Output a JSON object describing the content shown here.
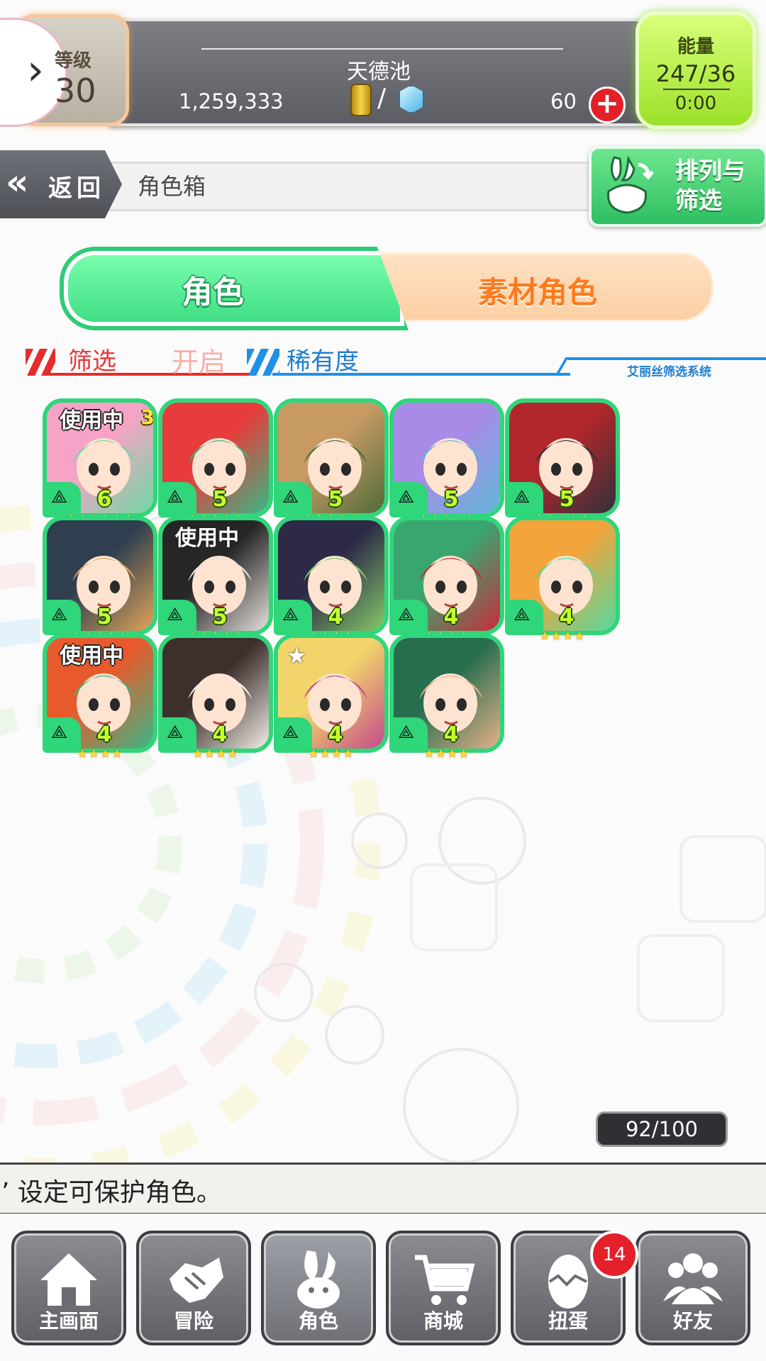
{
  "header": {
    "level_label": "等级",
    "level_value": "30",
    "player_name": "天德池",
    "coins": "1,259,333",
    "gems": "60",
    "energy_label": "能量",
    "energy_value": "247/36",
    "energy_timer": "0:00"
  },
  "nav": {
    "back_label": "返回",
    "page_title": "角色箱",
    "sort_filter_label": "排列与筛选"
  },
  "tabs": {
    "characters": "角色",
    "material_characters": "素材角色"
  },
  "filter": {
    "label": "筛选",
    "state": "开启",
    "sort_key": "稀有度",
    "system_label": "艾丽丝筛选系统"
  },
  "characters": [
    {
      "level": "6",
      "stars": 6,
      "in_use": "使用中",
      "plus": "3",
      "colors": [
        "#f7a3c7",
        "#6dd9a2"
      ]
    },
    {
      "level": "5",
      "stars": 5,
      "colors": [
        "#e83b3b",
        "#37b884"
      ]
    },
    {
      "level": "5",
      "stars": 5,
      "colors": [
        "#c79a64",
        "#4f6b3a"
      ]
    },
    {
      "level": "5",
      "stars": 5,
      "colors": [
        "#a98ae6",
        "#62b6d9"
      ]
    },
    {
      "level": "5",
      "stars": 5,
      "colors": [
        "#b1272b",
        "#30303a"
      ]
    },
    {
      "level": "5",
      "stars": 5,
      "colors": [
        "#2f3f4f",
        "#e0a35a"
      ]
    },
    {
      "level": "5",
      "stars": 5,
      "in_use": "使用中",
      "colors": [
        "#262626",
        "#e6e0dc"
      ]
    },
    {
      "level": "4",
      "stars": 4,
      "colors": [
        "#2c2a46",
        "#86c86a"
      ]
    },
    {
      "level": "4",
      "stars": 4,
      "colors": [
        "#3aa66f",
        "#c72c3c"
      ]
    },
    {
      "level": "4",
      "stars": 4,
      "colors": [
        "#f3a43a",
        "#53d9a0"
      ]
    },
    {
      "level": "4",
      "stars": 4,
      "in_use": "使用中",
      "colors": [
        "#e85a2c",
        "#3ab787"
      ]
    },
    {
      "level": "4",
      "stars": 4,
      "colors": [
        "#3c2f2c",
        "#f2ede6"
      ]
    },
    {
      "level": "4",
      "stars": 4,
      "star_mark": "★",
      "colors": [
        "#f2d56a",
        "#c44a8c"
      ]
    },
    {
      "level": "4",
      "stars": 4,
      "colors": [
        "#266e4e",
        "#e7b08a"
      ]
    }
  ],
  "capacity": "92/100",
  "tip": "’ 设定可保护角色。",
  "bottom_nav": [
    {
      "label": "主画面",
      "icon": "home-icon"
    },
    {
      "label": "冒险",
      "icon": "handshake-icon"
    },
    {
      "label": "角色",
      "icon": "rabbit-icon"
    },
    {
      "label": "商城",
      "icon": "cart-icon"
    },
    {
      "label": "扭蛋",
      "icon": "egg-icon",
      "badge": "14"
    },
    {
      "label": "好友",
      "icon": "friends-icon"
    }
  ],
  "colors": {
    "accent_green": "#2fd67a",
    "accent_orange": "#ff7a1c",
    "filter_red": "#e62b2b",
    "filter_blue": "#1e90e6"
  }
}
